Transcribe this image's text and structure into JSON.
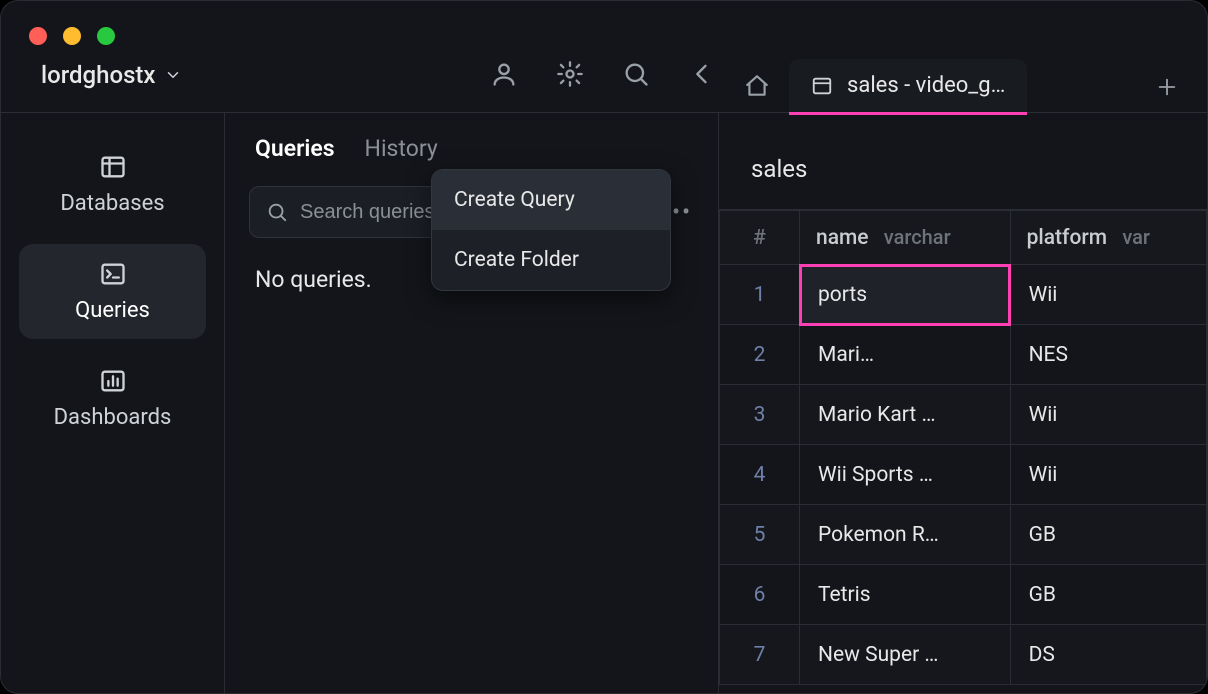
{
  "workspace": {
    "name": "lordghostx"
  },
  "leftnav": {
    "items": [
      {
        "label": "Databases"
      },
      {
        "label": "Queries"
      },
      {
        "label": "Dashboards"
      }
    ],
    "active_index": 1
  },
  "midcol": {
    "tabs": {
      "queries": "Queries",
      "history": "History"
    },
    "search_placeholder": "Search queries",
    "empty_text": "No queries."
  },
  "context_menu": {
    "items": [
      {
        "label": "Create Query"
      },
      {
        "label": "Create Folder"
      }
    ],
    "hover_index": 0
  },
  "tabs": {
    "active_label": "sales - video_g…"
  },
  "breadcrumb": "sales",
  "table": {
    "rownum_header": "#",
    "columns": [
      {
        "name": "name",
        "type": "varchar"
      },
      {
        "name": "platform",
        "type": "var"
      }
    ],
    "rows": [
      {
        "num": "1",
        "name": "ports",
        "platform": "Wii"
      },
      {
        "num": "2",
        "name": "Mari…",
        "platform": "NES"
      },
      {
        "num": "3",
        "name": "Mario Kart …",
        "platform": "Wii"
      },
      {
        "num": "4",
        "name": "Wii Sports …",
        "platform": "Wii"
      },
      {
        "num": "5",
        "name": "Pokemon R…",
        "platform": "GB"
      },
      {
        "num": "6",
        "name": "Tetris",
        "platform": "GB"
      },
      {
        "num": "7",
        "name": "New Super …",
        "platform": "DS"
      }
    ],
    "selected": {
      "row": 0,
      "col": 0
    }
  }
}
